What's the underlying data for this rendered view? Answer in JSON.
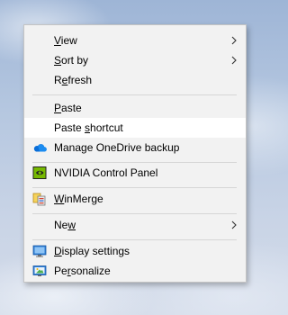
{
  "menu": {
    "items": {
      "view": {
        "pre": "",
        "key": "V",
        "post": "iew",
        "submenu": true
      },
      "sort_by": {
        "pre": "",
        "key": "S",
        "post": "ort by",
        "submenu": true
      },
      "refresh": {
        "pre": "R",
        "key": "e",
        "post": "fresh"
      },
      "paste": {
        "pre": "",
        "key": "P",
        "post": "aste"
      },
      "paste_shortcut": {
        "pre": "Paste ",
        "key": "s",
        "post": "hortcut",
        "highlighted": true
      },
      "onedrive": {
        "label": "Manage OneDrive backup",
        "icon": "onedrive-icon"
      },
      "nvidia": {
        "label": "NVIDIA Control Panel",
        "icon": "nvidia-icon"
      },
      "winmerge": {
        "pre": "",
        "key": "W",
        "post": "inMerge",
        "icon": "winmerge-icon"
      },
      "new": {
        "pre": "Ne",
        "key": "w",
        "post": "",
        "submenu": true
      },
      "display_settings": {
        "pre": "",
        "key": "D",
        "post": "isplay settings",
        "icon": "display-settings-icon"
      },
      "personalize": {
        "pre": "Pe",
        "key": "r",
        "post": "sonalize",
        "icon": "personalize-icon"
      }
    },
    "colors": {
      "background": "#f2f2f2",
      "hover": "#ffffff",
      "separator": "#d6d6d6"
    }
  }
}
